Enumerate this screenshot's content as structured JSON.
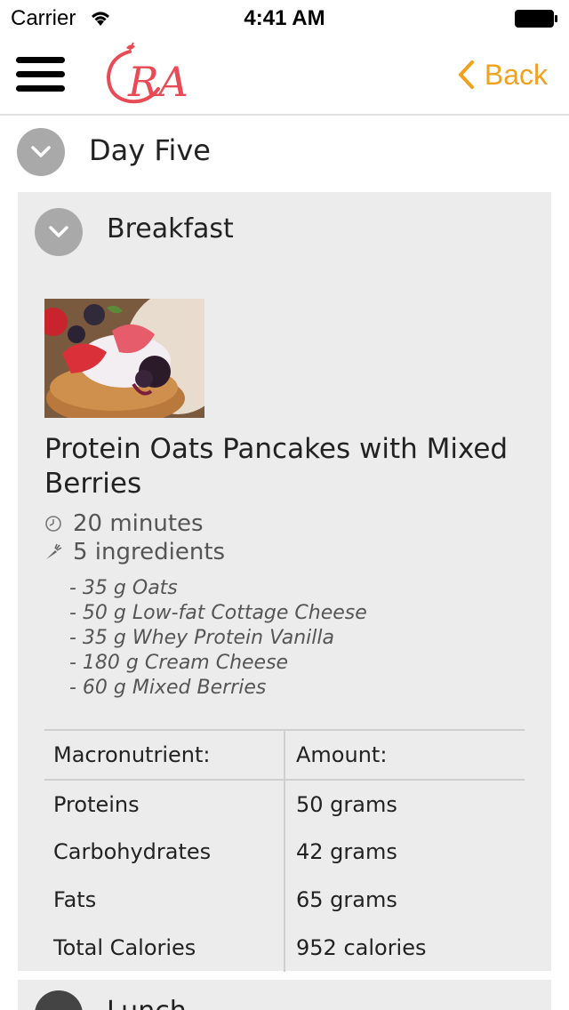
{
  "status_bar": {
    "carrier": "Carrier",
    "time": "4:41 AM"
  },
  "nav": {
    "logo_text": "RA",
    "back_label": "Back",
    "accent_color": "#f0a11e",
    "logo_color": "#e84b55"
  },
  "day": {
    "title": "Day Five"
  },
  "meal": {
    "title": "Breakfast",
    "recipe_title": "Protein Oats Pancakes with Mixed Berries",
    "time": "20 minutes",
    "ingredient_count": "5 ingredients",
    "ingredients": [
      "- 35 g Oats",
      "- 50 g Low-fat Cottage Cheese",
      "- 35 g Whey Protein Vanilla",
      "- 180 g Cream Cheese",
      "- 60 g Mixed Berries"
    ],
    "table": {
      "headers": [
        "Macronutrient:",
        "Amount:"
      ],
      "rows": [
        [
          "Proteins",
          "50 grams"
        ],
        [
          "Carbohydrates",
          "42 grams"
        ],
        [
          "Fats",
          "65 grams"
        ],
        [
          "Total Calories",
          "952 calories"
        ]
      ]
    }
  },
  "next_section": {
    "title": "Lunch"
  },
  "icons": {
    "menu": "hamburger-icon",
    "back": "chevron-left-icon",
    "expand": "chevron-down-icon",
    "time": "clock-icon",
    "ingredients": "carrot-icon"
  }
}
